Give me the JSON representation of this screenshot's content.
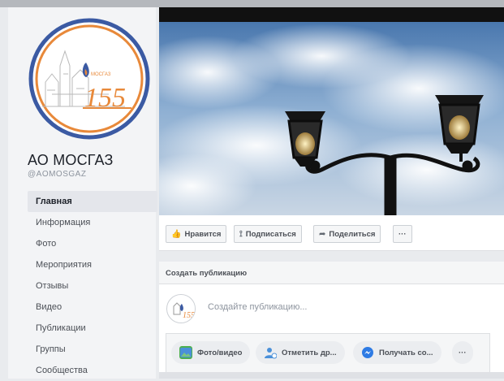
{
  "page": {
    "name": "АО МОСГАЗ",
    "handle": "@AOMOSGAZ",
    "logo_text": "155"
  },
  "nav": {
    "items": [
      {
        "label": "Главная",
        "active": true
      },
      {
        "label": "Информация"
      },
      {
        "label": "Фото"
      },
      {
        "label": "Мероприятия"
      },
      {
        "label": "Отзывы"
      },
      {
        "label": "Видео"
      },
      {
        "label": "Публикации"
      },
      {
        "label": "Группы"
      },
      {
        "label": "Сообщества"
      }
    ]
  },
  "actions": {
    "like": "Нравится",
    "follow": "Подписаться",
    "share": "Поделиться",
    "more": "···"
  },
  "create_post": {
    "title": "Создать публикацию",
    "placeholder": "Создайте публикацию...",
    "chips": {
      "photo": "Фото/видео",
      "tag": "Отметить др...",
      "get": "Получать со...",
      "more": "···"
    }
  },
  "colors": {
    "brand_blue": "#4267b2",
    "logo_orange": "#e8893a",
    "logo_blue": "#3b5aa3"
  }
}
